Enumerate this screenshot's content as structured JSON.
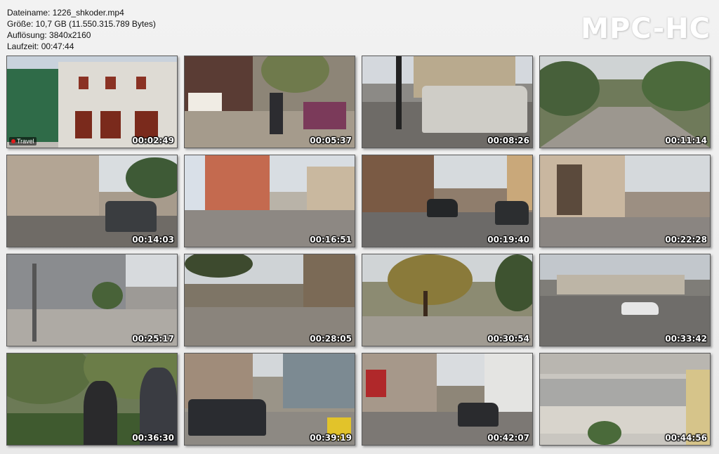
{
  "info": {
    "filename": "Dateiname: 1226_shkoder.mp4",
    "size": "Größe: 10,7 GB (11.550.315.789 Bytes)",
    "resolution": "Auflösung: 3840x2160",
    "duration": "Laufzeit: 00:47:44"
  },
  "logo": "MPC-HC",
  "thumbnails": [
    {
      "time": "00:02:49",
      "badge": "Travel"
    },
    {
      "time": "00:05:37"
    },
    {
      "time": "00:08:26"
    },
    {
      "time": "00:11:14"
    },
    {
      "time": "00:14:03"
    },
    {
      "time": "00:16:51"
    },
    {
      "time": "00:19:40"
    },
    {
      "time": "00:22:28"
    },
    {
      "time": "00:25:17"
    },
    {
      "time": "00:28:05"
    },
    {
      "time": "00:30:54"
    },
    {
      "time": "00:33:42"
    },
    {
      "time": "00:36:30"
    },
    {
      "time": "00:39:19"
    },
    {
      "time": "00:42:07"
    },
    {
      "time": "00:44:56"
    }
  ]
}
